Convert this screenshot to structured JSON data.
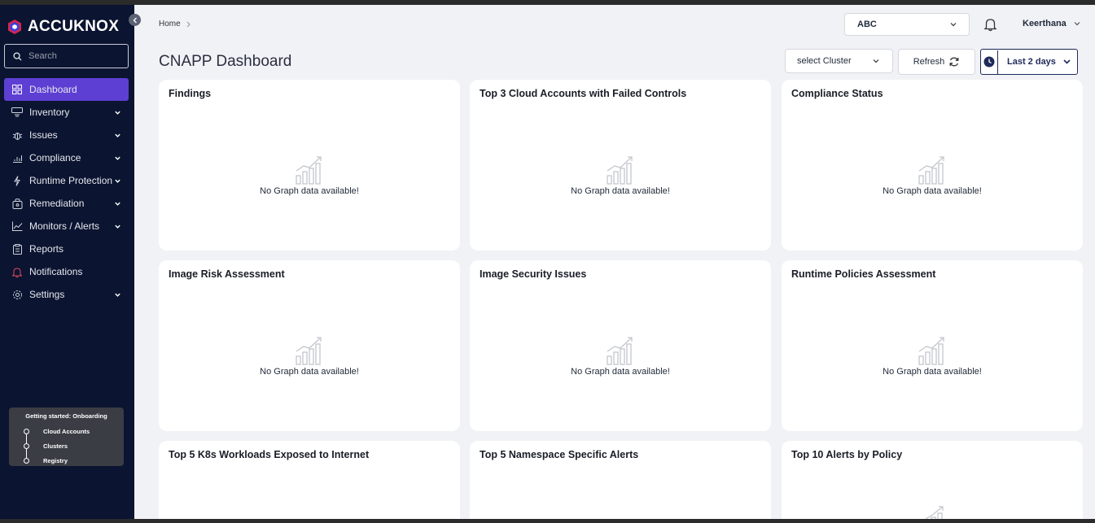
{
  "app": {
    "brand": "ACCUKNOX"
  },
  "sidebar": {
    "search_placeholder": "Search",
    "items": [
      {
        "label": "Dashboard",
        "icon": "grid-icon",
        "active": true,
        "has_children": false
      },
      {
        "label": "Inventory",
        "icon": "inventory-icon",
        "has_children": true
      },
      {
        "label": "Issues",
        "icon": "bug-icon",
        "has_children": true
      },
      {
        "label": "Compliance",
        "icon": "bar-chart-icon",
        "has_children": true
      },
      {
        "label": "Runtime Protection",
        "icon": "lightning-icon",
        "has_children": true
      },
      {
        "label": "Remediation",
        "icon": "bag-icon",
        "has_children": true
      },
      {
        "label": "Monitors / Alerts",
        "icon": "line-chart-icon",
        "has_children": true
      },
      {
        "label": "Reports",
        "icon": "clipboard-icon",
        "has_children": false
      },
      {
        "label": "Notifications",
        "icon": "bell-icon",
        "has_children": false
      },
      {
        "label": "Settings",
        "icon": "gear-icon",
        "has_children": true
      }
    ],
    "onboarding": {
      "title": "Getting started: Onboarding",
      "steps": [
        "Cloud Accounts",
        "Clusters",
        "Registry"
      ]
    }
  },
  "header": {
    "breadcrumb": "Home",
    "org_select": "ABC",
    "user_name": "Keerthana",
    "page_title": "CNAPP Dashboard",
    "cluster_select": "select Cluster",
    "refresh_label": "Refresh",
    "date_range": "Last 2 days"
  },
  "cards": [
    {
      "title": "Findings",
      "empty": "No Graph data available!"
    },
    {
      "title": "Top 3 Cloud Accounts with Failed Controls",
      "empty": "No Graph data available!"
    },
    {
      "title": "Compliance Status",
      "empty": "No Graph data available!"
    },
    {
      "title": "Image Risk Assessment",
      "empty": "No Graph data available!"
    },
    {
      "title": "Image Security Issues",
      "empty": "No Graph data available!"
    },
    {
      "title": "Runtime Policies Assessment",
      "empty": "No Graph data available!"
    },
    {
      "title": "Top 5 K8s Workloads Exposed to Internet",
      "empty": ""
    },
    {
      "title": "Top 5 Namespace Specific Alerts",
      "empty": ""
    },
    {
      "title": "Top 10 Alerts by Policy",
      "empty": ""
    }
  ],
  "colors": {
    "sidebar_bg": "#0b1430",
    "active_nav": "#5d3fd3",
    "page_bg": "#f1f2f6",
    "accent_navy": "#1e2a5a"
  }
}
